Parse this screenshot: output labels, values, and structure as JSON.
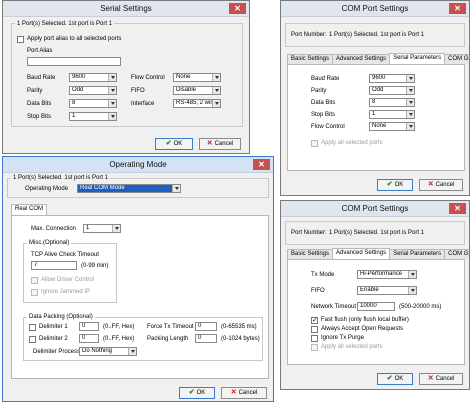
{
  "serial": {
    "title": "Serial Settings",
    "ports_selected": "1 Port(s) Selected.  1st port is Port 1",
    "apply_alias": "Apply port alias to all selected ports",
    "port_alias_label": "Port Alias",
    "port_alias_value": "",
    "baud_label": "Baud Rate",
    "baud_value": "9600",
    "parity_label": "Parity",
    "parity_value": "Odd",
    "databits_label": "Data Bits",
    "databits_value": "8",
    "stopbits_label": "Stop Bits",
    "stopbits_value": "1",
    "flow_label": "Flow Control",
    "flow_value": "None",
    "fifo_label": "FIFO",
    "fifo_value": "Disable",
    "interface_label": "Interface",
    "interface_value": "RS-485, 2 wire",
    "ok": "OK",
    "cancel": "Cancel"
  },
  "com1": {
    "title": "COM Port Settings",
    "port_number_label": "Port Number:",
    "port_number_value": "1 Port(s) Selected.  1st port is Port 1",
    "tabs": [
      "Basic Settings",
      "Advanced Settings",
      "Serial Parameters",
      "COM Grouping"
    ],
    "baud_label": "Baud Rate",
    "baud_value": "9600",
    "parity_label": "Parity",
    "parity_value": "Odd",
    "databits_label": "Data Bits",
    "databits_value": "8",
    "stopbits_label": "Stop Bits",
    "stopbits_value": "1",
    "flow_label": "Flow Control",
    "flow_value": "None",
    "apply_all": "Apply all selected ports",
    "ok": "OK",
    "cancel": "Cancel"
  },
  "opmode": {
    "title": "Operating Mode",
    "ports_selected": "1 Port(s) Selected.  1st port is Port 1",
    "mode_label": "Operating Mode",
    "mode_value": "Real COM Mode",
    "tab": "Real COM",
    "max_conn_label": "Max. Connection",
    "max_conn_value": "1",
    "misc_label": "Misc.(Optional)",
    "tcp_label": "TCP Alive Check Timeout",
    "tcp_value": "7",
    "tcp_range": "(0-99 min)",
    "allow_driver": "Allow Driver Control",
    "ignore_jammed": "Ignore Jammed IP",
    "packing_label": "Data Packing (Optional)",
    "delim1_label": "Delimiter 1",
    "delim1_value": "0",
    "delim2_label": "Delimiter 2",
    "delim2_value": "0",
    "hex_label": "(0..FF, Hex)",
    "force_label": "Force Tx Timeout",
    "force_value": "0",
    "force_range": "(0-65535 ms)",
    "packlen_label": "Packing Length",
    "packlen_value": "0",
    "packlen_range": "(0-1024 bytes)",
    "delimproc_label": "Delimiter Process",
    "delimproc_value": "Do Nothing",
    "ok": "OK",
    "cancel": "Cancel"
  },
  "com2": {
    "title": "COM Port Settings",
    "port_number_label": "Port Number:",
    "port_number_value": "1 Port(s) Selected.  1st port is Port 1",
    "tabs": [
      "Basic Settings",
      "Advanced Settings",
      "Serial Parameters",
      "COM Grouping"
    ],
    "txmode_label": "Tx Mode",
    "txmode_value": "Hi-Performance",
    "fifo_label": "FIFO",
    "fifo_value": "Enable",
    "nettimeout_label": "Network Timeout",
    "nettimeout_value": "10000",
    "nettimeout_range": "(500-20000 ms)",
    "fast_flush": "Fast flush (only flush local buffer)",
    "always_accept": "Always Accept Open Requests",
    "ignore_purge": "Ignore Tx Purge",
    "apply_all": "Apply all selected ports",
    "ok": "OK",
    "cancel": "Cancel"
  }
}
